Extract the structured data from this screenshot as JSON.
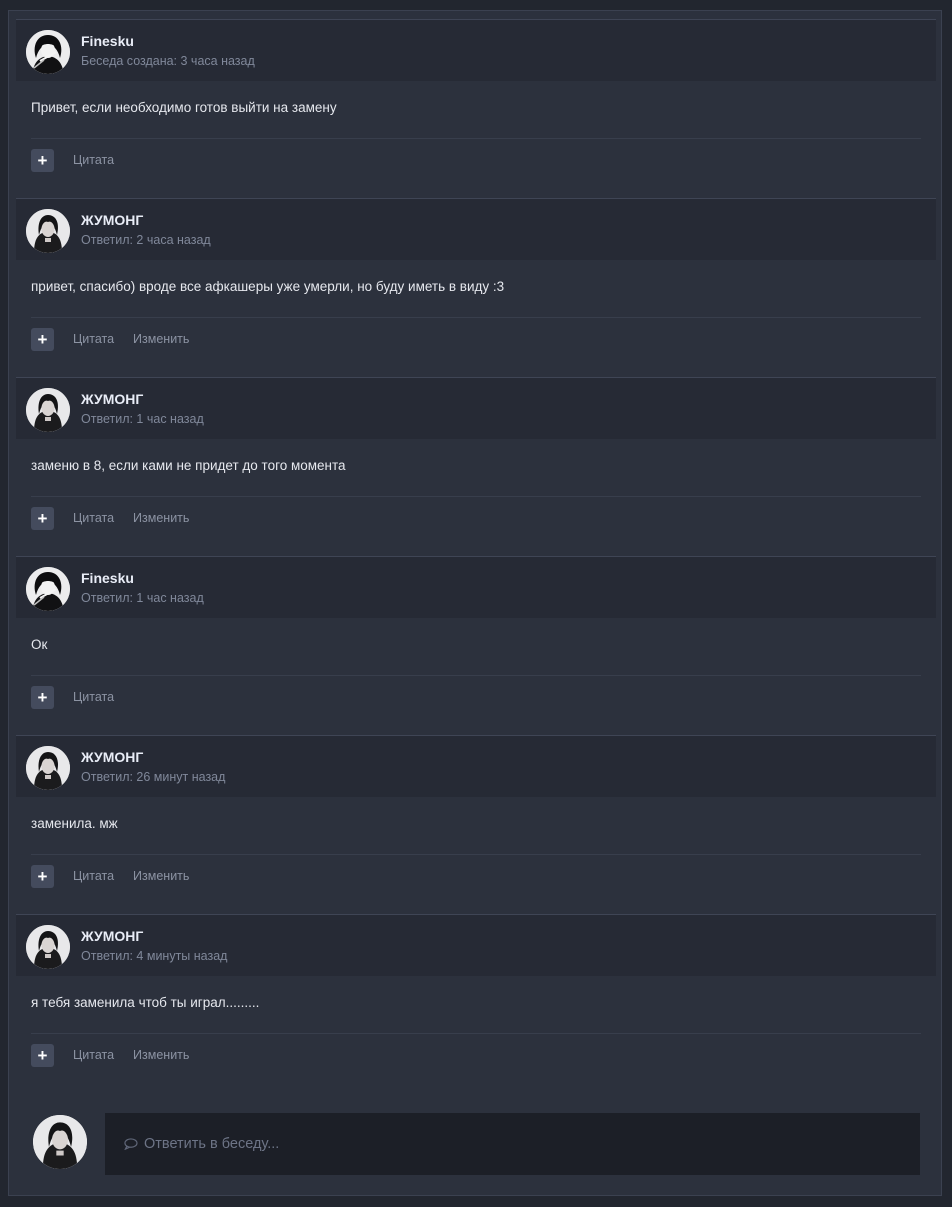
{
  "posts": [
    {
      "author": "Finesku",
      "meta": "Беседа создана: 3 часа назад",
      "text": "Привет, если необходимо готов выйти на замену",
      "avatar": "avatar-finesku",
      "actions": [
        "Цитата"
      ]
    },
    {
      "author": "ЖУМОНГ",
      "meta": "Ответил: 2 часа назад",
      "text": "привет, спасибо) вроде все афкашеры уже умерли, но буду иметь в виду :3",
      "avatar": "avatar-zhumong",
      "actions": [
        "Цитата",
        "Изменить"
      ]
    },
    {
      "author": "ЖУМОНГ",
      "meta": "Ответил: 1 час назад",
      "text": "заменю в 8, если ками не придет до того момента",
      "avatar": "avatar-zhumong",
      "actions": [
        "Цитата",
        "Изменить"
      ]
    },
    {
      "author": "Finesku",
      "meta": "Ответил: 1 час назад",
      "text": "Ок",
      "avatar": "avatar-finesku",
      "actions": [
        "Цитата"
      ]
    },
    {
      "author": "ЖУМОНГ",
      "meta": "Ответил: 26 минут назад",
      "text": "заменила. мж",
      "avatar": "avatar-zhumong",
      "actions": [
        "Цитата",
        "Изменить"
      ]
    },
    {
      "author": "ЖУМОНГ",
      "meta": "Ответил: 4 минуты назад",
      "text": "я тебя заменила чтоб ты играл.........",
      "avatar": "avatar-zhumong",
      "actions": [
        "Цитата",
        "Изменить"
      ]
    }
  ],
  "plus_icon": "+",
  "reply": {
    "placeholder": "Ответить в беседу...",
    "icon": "chat-bubble-icon"
  },
  "colors": {
    "background": "#2c313d",
    "header": "#262a35",
    "input": "#1c1f27",
    "accent_button": "#444b5d"
  }
}
